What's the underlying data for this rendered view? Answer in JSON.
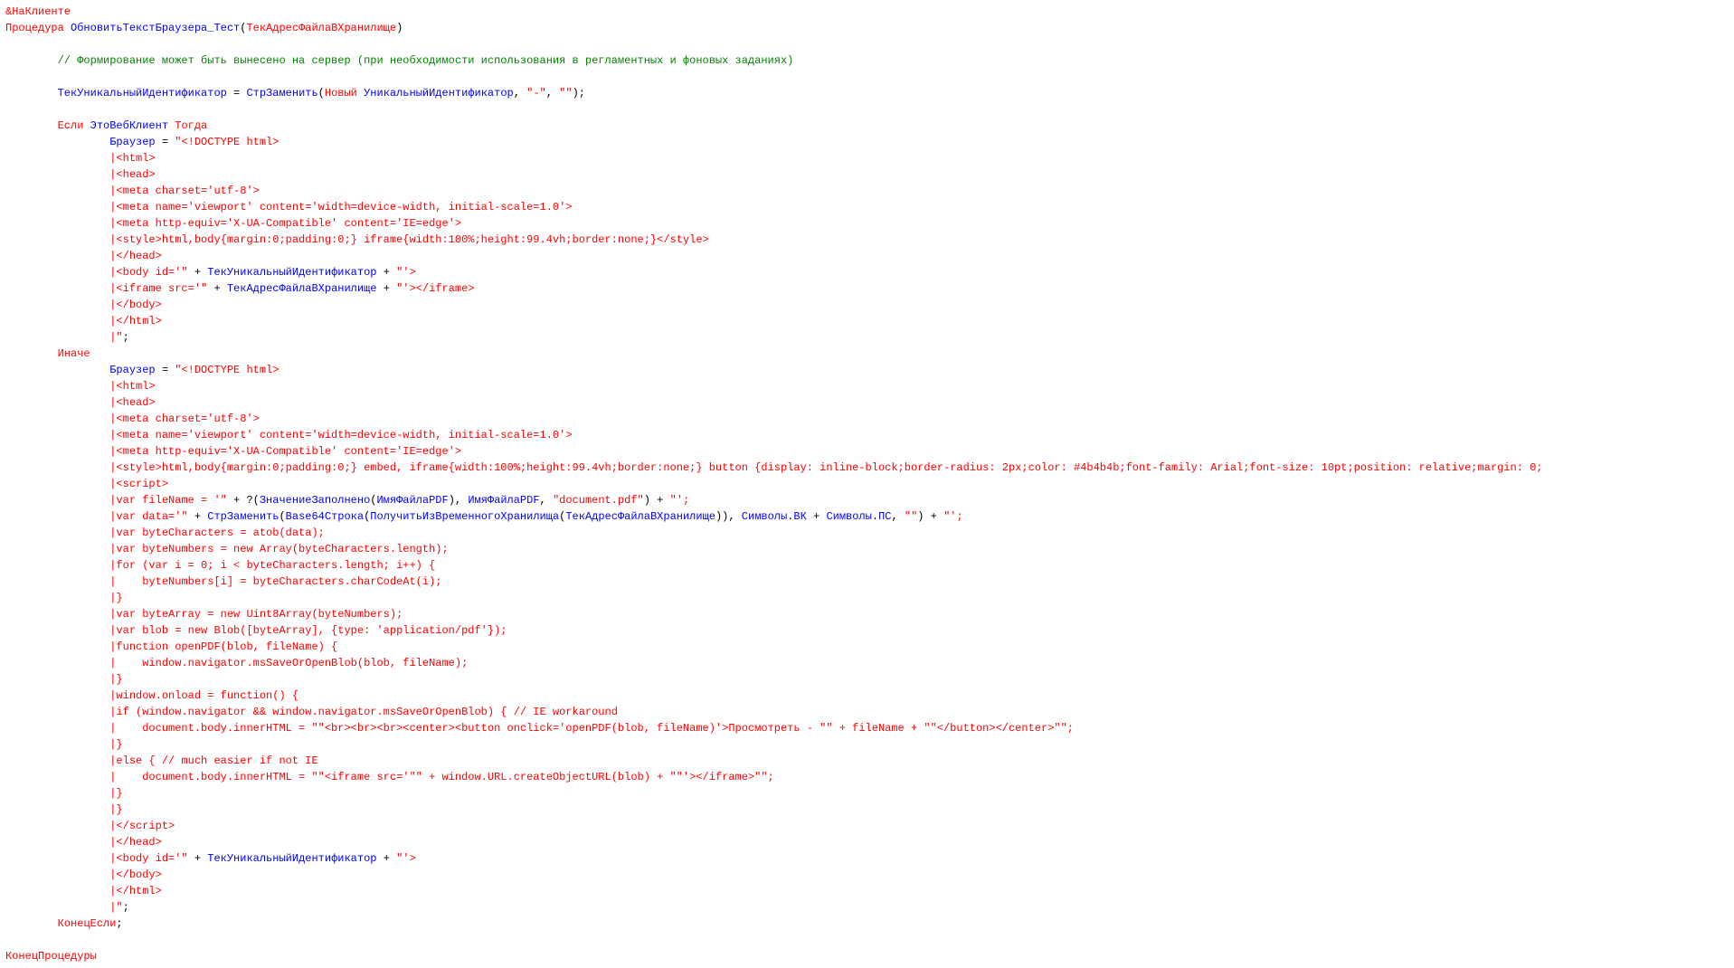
{
  "lines": [
    [
      {
        "c": "red",
        "t": "&НаКлиенте"
      }
    ],
    [
      {
        "c": "red",
        "t": "Процедура"
      },
      {
        "t": " "
      },
      {
        "c": "blue",
        "t": "ОбновитьТекстБраузера_Тест"
      },
      {
        "t": "("
      },
      {
        "c": "red",
        "t": "ТекАдресФайлаВХранилище"
      },
      {
        "t": ")"
      }
    ],
    [
      {
        "t": ""
      }
    ],
    [
      {
        "t": "        "
      },
      {
        "c": "green",
        "t": "// Формирование может быть вынесено на сервер (при необходимости использования в регламентных и фоновых заданиях)"
      }
    ],
    [
      {
        "t": ""
      }
    ],
    [
      {
        "t": "        "
      },
      {
        "c": "blue",
        "t": "ТекУникальныйИдентификатор"
      },
      {
        "t": " = "
      },
      {
        "c": "blue",
        "t": "СтрЗаменить"
      },
      {
        "t": "("
      },
      {
        "c": "red",
        "t": "Новый"
      },
      {
        "t": " "
      },
      {
        "c": "blue",
        "t": "УникальныйИдентификатор"
      },
      {
        "t": ", "
      },
      {
        "c": "red",
        "t": "\"-\""
      },
      {
        "t": ", "
      },
      {
        "c": "red",
        "t": "\"\""
      },
      {
        "t": ");"
      }
    ],
    [
      {
        "t": ""
      }
    ],
    [
      {
        "t": "        "
      },
      {
        "c": "red",
        "t": "Если"
      },
      {
        "t": " "
      },
      {
        "c": "blue",
        "t": "ЭтоВебКлиент"
      },
      {
        "t": " "
      },
      {
        "c": "red",
        "t": "Тогда"
      }
    ],
    [
      {
        "t": "                "
      },
      {
        "c": "blue",
        "t": "Браузер"
      },
      {
        "t": " = "
      },
      {
        "c": "red",
        "t": "\"<!DOCTYPE html>"
      }
    ],
    [
      {
        "t": "                "
      },
      {
        "c": "red",
        "t": "|<html>"
      }
    ],
    [
      {
        "t": "                "
      },
      {
        "c": "red",
        "t": "|<head>"
      }
    ],
    [
      {
        "t": "                "
      },
      {
        "c": "red",
        "t": "|<meta charset='utf-8'>"
      }
    ],
    [
      {
        "t": "                "
      },
      {
        "c": "red",
        "t": "|<meta name='viewport' content='width=device-width, initial-scale=1.0'>"
      }
    ],
    [
      {
        "t": "                "
      },
      {
        "c": "red",
        "t": "|<meta http-equiv='X-UA-Compatible' content='IE=edge'>"
      }
    ],
    [
      {
        "t": "                "
      },
      {
        "c": "red",
        "t": "|<style>html,body{margin:0;padding:0;} iframe{width:100%;height:99.4vh;border:none;}</style>"
      }
    ],
    [
      {
        "t": "                "
      },
      {
        "c": "red",
        "t": "|</head>"
      }
    ],
    [
      {
        "t": "                "
      },
      {
        "c": "red",
        "t": "|<body id='\""
      },
      {
        "t": " + "
      },
      {
        "c": "blue",
        "t": "ТекУникальныйИдентификатор"
      },
      {
        "t": " + "
      },
      {
        "c": "red",
        "t": "\"'>"
      }
    ],
    [
      {
        "t": "                "
      },
      {
        "c": "red",
        "t": "|<iframe src='\""
      },
      {
        "t": " + "
      },
      {
        "c": "blue",
        "t": "ТекАдресФайлаВХранилище"
      },
      {
        "t": " + "
      },
      {
        "c": "red",
        "t": "\"'></iframe>"
      }
    ],
    [
      {
        "t": "                "
      },
      {
        "c": "red",
        "t": "|</body>"
      }
    ],
    [
      {
        "t": "                "
      },
      {
        "c": "red",
        "t": "|</html>"
      }
    ],
    [
      {
        "t": "                "
      },
      {
        "c": "red",
        "t": "|\""
      },
      {
        "t": ";"
      }
    ],
    [
      {
        "t": "        "
      },
      {
        "c": "red",
        "t": "Иначе"
      }
    ],
    [
      {
        "t": "                "
      },
      {
        "c": "blue",
        "t": "Браузер"
      },
      {
        "t": " = "
      },
      {
        "c": "red",
        "t": "\"<!DOCTYPE html>"
      }
    ],
    [
      {
        "t": "                "
      },
      {
        "c": "red",
        "t": "|<html>"
      }
    ],
    [
      {
        "t": "                "
      },
      {
        "c": "red",
        "t": "|<head>"
      }
    ],
    [
      {
        "t": "                "
      },
      {
        "c": "red",
        "t": "|<meta charset='utf-8'>"
      }
    ],
    [
      {
        "t": "                "
      },
      {
        "c": "red",
        "t": "|<meta name='viewport' content='width=device-width, initial-scale=1.0'>"
      }
    ],
    [
      {
        "t": "                "
      },
      {
        "c": "red",
        "t": "|<meta http-equiv='X-UA-Compatible' content='IE=edge'>"
      }
    ],
    [
      {
        "t": "                "
      },
      {
        "c": "red",
        "t": "|<style>html,body{margin:0;padding:0;} embed, iframe{width:100%;height:99.4vh;border:none;} button {display: inline-block;border-radius: 2px;color: #4b4b4b;font-family: Arial;font-size: 10pt;position: relative;margin: 0;"
      }
    ],
    [
      {
        "t": "                "
      },
      {
        "c": "red",
        "t": "|<script>"
      }
    ],
    [
      {
        "t": "                "
      },
      {
        "c": "red",
        "t": "|var fileName = '\""
      },
      {
        "t": " + ?("
      },
      {
        "c": "blue",
        "t": "ЗначениеЗаполнено"
      },
      {
        "t": "("
      },
      {
        "c": "blue",
        "t": "ИмяФайлаPDF"
      },
      {
        "t": "), "
      },
      {
        "c": "blue",
        "t": "ИмяФайлаPDF"
      },
      {
        "t": ", "
      },
      {
        "c": "red",
        "t": "\"document.pdf\""
      },
      {
        "t": ") + "
      },
      {
        "c": "red",
        "t": "\"';"
      }
    ],
    [
      {
        "t": "                "
      },
      {
        "c": "red",
        "t": "|var data='\""
      },
      {
        "t": " + "
      },
      {
        "c": "blue",
        "t": "СтрЗаменить"
      },
      {
        "t": "("
      },
      {
        "c": "blue",
        "t": "Base64Строка"
      },
      {
        "t": "("
      },
      {
        "c": "blue",
        "t": "ПолучитьИзВременногоХранилища"
      },
      {
        "t": "("
      },
      {
        "c": "blue",
        "t": "ТекАдресФайлаВХранилище"
      },
      {
        "t": ")), "
      },
      {
        "c": "blue",
        "t": "Символы"
      },
      {
        "t": "."
      },
      {
        "c": "blue",
        "t": "ВК"
      },
      {
        "t": " + "
      },
      {
        "c": "blue",
        "t": "Символы"
      },
      {
        "t": "."
      },
      {
        "c": "blue",
        "t": "ПС"
      },
      {
        "t": ", "
      },
      {
        "c": "red",
        "t": "\"\""
      },
      {
        "t": ") + "
      },
      {
        "c": "red",
        "t": "\"';"
      }
    ],
    [
      {
        "t": "                "
      },
      {
        "c": "red",
        "t": "|var byteCharacters = atob(data);"
      }
    ],
    [
      {
        "t": "                "
      },
      {
        "c": "red",
        "t": "|var byteNumbers = new Array(byteCharacters.length);"
      }
    ],
    [
      {
        "t": "                "
      },
      {
        "c": "red",
        "t": "|for (var i = 0; i < byteCharacters.length; i++) {"
      }
    ],
    [
      {
        "t": "                "
      },
      {
        "c": "red",
        "t": "|    byteNumbers[i] = byteCharacters.charCodeAt(i);"
      }
    ],
    [
      {
        "t": "                "
      },
      {
        "c": "red",
        "t": "|}"
      }
    ],
    [
      {
        "t": "                "
      },
      {
        "c": "red",
        "t": "|var byteArray = new Uint8Array(byteNumbers);"
      }
    ],
    [
      {
        "t": "                "
      },
      {
        "c": "red",
        "t": "|var blob = new Blob([byteArray], {type: 'application/pdf'});"
      }
    ],
    [
      {
        "t": "                "
      },
      {
        "c": "red",
        "t": "|function openPDF(blob, fileName) {"
      }
    ],
    [
      {
        "t": "                "
      },
      {
        "c": "red",
        "t": "|    window.navigator.msSaveOrOpenBlob(blob, fileName);"
      }
    ],
    [
      {
        "t": "                "
      },
      {
        "c": "red",
        "t": "|}"
      }
    ],
    [
      {
        "t": "                "
      },
      {
        "c": "red",
        "t": "|window.onload = function() {"
      }
    ],
    [
      {
        "t": "                "
      },
      {
        "c": "red",
        "t": "|if (window.navigator && window.navigator.msSaveOrOpenBlob) { // IE workaround"
      }
    ],
    [
      {
        "t": "                "
      },
      {
        "c": "red",
        "t": "|    document.body.innerHTML = \"\"<br><br><br><center><button onclick='openPDF(blob, fileName)'>Просмотреть - \"\" + fileName + \"\"</button></center>\"\";"
      }
    ],
    [
      {
        "t": "                "
      },
      {
        "c": "red",
        "t": "|}"
      }
    ],
    [
      {
        "t": "                "
      },
      {
        "c": "red",
        "t": "|else { // much easier if not IE"
      }
    ],
    [
      {
        "t": "                "
      },
      {
        "c": "red",
        "t": "|    document.body.innerHTML = \"\"<iframe src='\"\" + window.URL.createObjectURL(blob) + \"\"'></iframe>\"\";"
      }
    ],
    [
      {
        "t": "                "
      },
      {
        "c": "red",
        "t": "|}"
      }
    ],
    [
      {
        "t": "                "
      },
      {
        "c": "red",
        "t": "|}"
      }
    ],
    [
      {
        "t": "                "
      },
      {
        "c": "red",
        "t": "|</scr_ipt>"
      }
    ],
    [
      {
        "t": "                "
      },
      {
        "c": "red",
        "t": "|</head>"
      }
    ],
    [
      {
        "t": "                "
      },
      {
        "c": "red",
        "t": "|<body id='\""
      },
      {
        "t": " + "
      },
      {
        "c": "blue",
        "t": "ТекУникальныйИдентификатор"
      },
      {
        "t": " + "
      },
      {
        "c": "red",
        "t": "\"'>"
      }
    ],
    [
      {
        "t": "                "
      },
      {
        "c": "red",
        "t": "|</body>"
      }
    ],
    [
      {
        "t": "                "
      },
      {
        "c": "red",
        "t": "|</html>"
      }
    ],
    [
      {
        "t": "                "
      },
      {
        "c": "red",
        "t": "|\""
      },
      {
        "t": ";"
      }
    ],
    [
      {
        "t": "        "
      },
      {
        "c": "red",
        "t": "КонецЕсли"
      },
      {
        "t": ";"
      }
    ],
    [
      {
        "t": ""
      }
    ],
    [
      {
        "c": "red",
        "t": "КонецПроцедуры"
      }
    ]
  ]
}
